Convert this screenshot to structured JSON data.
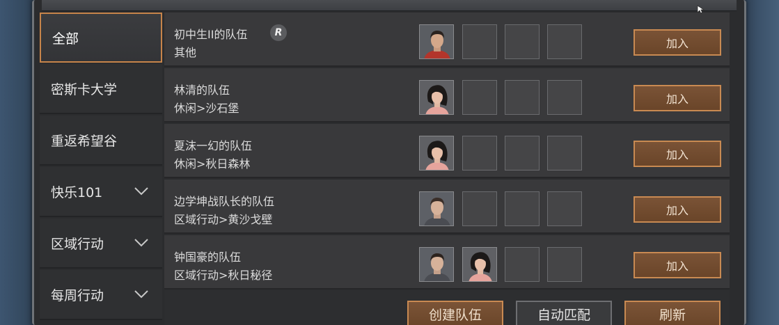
{
  "sidebar": {
    "items": [
      {
        "label": "全部",
        "active": true,
        "expandable": false
      },
      {
        "label": "密斯卡大学",
        "active": false,
        "expandable": false
      },
      {
        "label": "重返希望谷",
        "active": false,
        "expandable": false
      },
      {
        "label": "快乐101",
        "active": false,
        "expandable": true
      },
      {
        "label": "区域行动",
        "active": false,
        "expandable": true
      },
      {
        "label": "每周行动",
        "active": false,
        "expandable": true
      }
    ]
  },
  "teams": [
    {
      "name": "初中生II的队伍",
      "badge": "R",
      "location": "其他",
      "members": [
        "male-red-shirt"
      ],
      "join_label": "加入"
    },
    {
      "name": "林清的队伍",
      "badge": "",
      "location": "休闲>沙石堡",
      "members": [
        "female"
      ],
      "join_label": "加入"
    },
    {
      "name": "夏沫一幻的队伍",
      "badge": "",
      "location": "休闲>秋日森林",
      "members": [
        "female"
      ],
      "join_label": "加入"
    },
    {
      "name": "边学坤战队长的队伍",
      "badge": "",
      "location": "区域行动>黄沙戈壁",
      "members": [
        "male-grey-shirt"
      ],
      "join_label": "加入"
    },
    {
      "name": "钟国豪的队伍",
      "badge": "",
      "location": "区域行动>秋日秘径",
      "members": [
        "male-grey-shirt",
        "female"
      ],
      "join_label": "加入"
    }
  ],
  "max_members": 4,
  "footer": {
    "create_label": "创建队伍",
    "auto_match_label": "自动匹配",
    "refresh_label": "刷新"
  },
  "colors": {
    "accent_border": "#c98a52",
    "button_fill": "#6b462a",
    "panel_bg": "#2b2c2e",
    "row_bg": "#39393b"
  }
}
